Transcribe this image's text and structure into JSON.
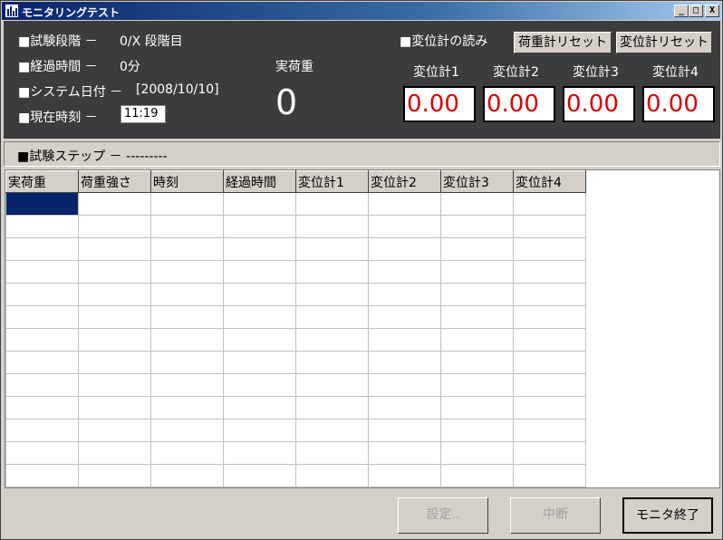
{
  "window": {
    "title": "モニタリングテスト",
    "minimize": "_",
    "maximize": "□",
    "close": "X"
  },
  "top": {
    "stage_label": "■試験段階 －",
    "stage_value": "0/X 段階目",
    "elapsed_label": "■経過時間 －",
    "elapsed_value": "0分",
    "sysdate_label": "■システム日付 －",
    "sysdate_value": "[2008/10/10]",
    "curtime_label": "■現在時刻 －",
    "curtime_value": "11:19",
    "actual_load_label": "実荷重",
    "actual_load_value": "0",
    "gauge_reading_label": "■変位計の読み",
    "reset_load_button": "荷重計リセット",
    "reset_disp_button": "変位計リセット",
    "gauges": [
      {
        "label": "変位計1",
        "value": "0.00"
      },
      {
        "label": "変位計2",
        "value": "0.00"
      },
      {
        "label": "変位計3",
        "value": "0.00"
      },
      {
        "label": "変位計4",
        "value": "0.00"
      }
    ]
  },
  "step": {
    "label": "■試験ステップ －",
    "value": "---------"
  },
  "grid": {
    "columns": [
      "実荷重",
      "荷重強さ",
      "時刻",
      "経過時間",
      "変位計1",
      "変位計2",
      "変位計3",
      "変位計4"
    ],
    "row_count": 13,
    "selected_cell": {
      "row": 0,
      "col": 0
    }
  },
  "bottom": {
    "settings_button": "設定..",
    "abort_button": "中断",
    "end_button": "モニタ終了"
  },
  "colors": {
    "panel_dark": "#3c3c3c",
    "gauge_value": "#e00000",
    "selection": "#0a246a"
  }
}
